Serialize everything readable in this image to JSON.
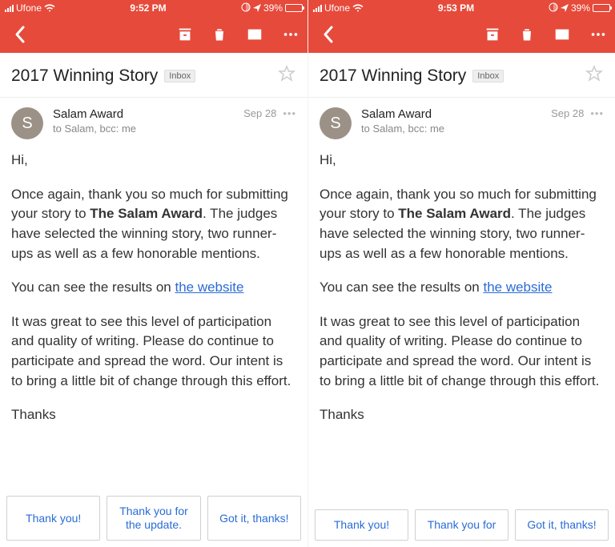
{
  "panes": [
    {
      "status": {
        "carrier": "Ufone",
        "time": "9:52 PM",
        "battery_pct": "39%"
      },
      "subject": "2017 Winning Story",
      "inbox_label": "Inbox",
      "sender": {
        "initial": "S",
        "name": "Salam Award",
        "to_line": "to Salam, bcc: me",
        "date": "Sep 28"
      },
      "body": {
        "greeting": "Hi,",
        "p1_a": "Once again, thank you so much for submitting your story to ",
        "p1_bold": "The Salam Award",
        "p1_b": ". The judges have selected the winning story, two runner-ups as well as a few honorable mentions.",
        "p2_a": "You can see the results on ",
        "p2_link": "the website",
        "p3": "It was great to see this level of participation and quality of writing. Please do continue to participate and spread the word. Our intent is to bring a little bit of change through this effort.",
        "signoff": "Thanks"
      },
      "replies": [
        "Thank you!",
        "Thank you for the update.",
        "Got it, thanks!"
      ]
    },
    {
      "status": {
        "carrier": "Ufone",
        "time": "9:53 PM",
        "battery_pct": "39%"
      },
      "subject": "2017 Winning Story",
      "inbox_label": "Inbox",
      "sender": {
        "initial": "S",
        "name": "Salam Award",
        "to_line": "to Salam, bcc: me",
        "date": "Sep 28"
      },
      "body": {
        "greeting": "Hi,",
        "p1_a": "Once again, thank you so much for submitting your story to ",
        "p1_bold": "The Salam Award",
        "p1_b": ". The judges have selected the winning story, two runner-ups as well as a few honorable mentions.",
        "p2_a": "You can see the results on ",
        "p2_link": "the website",
        "p3": "It was great to see this level of participation and quality of writing. Please do continue to participate and spread the word. Our intent is to bring a little bit of change through this effort.",
        "signoff": "Thanks"
      },
      "replies": [
        "Thank you!",
        "Thank you for",
        "Got it, thanks!"
      ]
    }
  ]
}
